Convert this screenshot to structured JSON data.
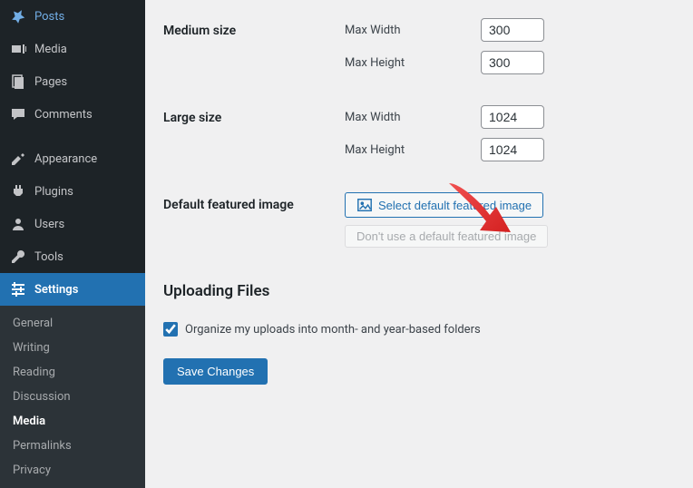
{
  "sidebar": {
    "main": [
      {
        "label": "Posts",
        "icon": "pin"
      },
      {
        "label": "Media",
        "icon": "media"
      },
      {
        "label": "Pages",
        "icon": "pages"
      },
      {
        "label": "Comments",
        "icon": "comments"
      }
    ],
    "secondary": [
      {
        "label": "Appearance",
        "icon": "appearance"
      },
      {
        "label": "Plugins",
        "icon": "plugins"
      },
      {
        "label": "Users",
        "icon": "users"
      },
      {
        "label": "Tools",
        "icon": "tools"
      },
      {
        "label": "Settings",
        "icon": "settings",
        "current": true
      }
    ],
    "submenu": [
      {
        "label": "General"
      },
      {
        "label": "Writing"
      },
      {
        "label": "Reading"
      },
      {
        "label": "Discussion"
      },
      {
        "label": "Media",
        "current": true
      },
      {
        "label": "Permalinks"
      },
      {
        "label": "Privacy"
      }
    ]
  },
  "settings": {
    "medium_size_label": "Medium size",
    "large_size_label": "Large size",
    "max_width_label": "Max Width",
    "max_height_label": "Max Height",
    "medium_width": "300",
    "medium_height": "300",
    "large_width": "1024",
    "large_height": "1024",
    "default_featured_label": "Default featured image",
    "select_button": "Select default featured image",
    "dont_use_button": "Don't use a default featured image",
    "uploading_heading": "Uploading Files",
    "organize_label": "Organize my uploads into month- and year-based folders",
    "save_label": "Save Changes"
  }
}
